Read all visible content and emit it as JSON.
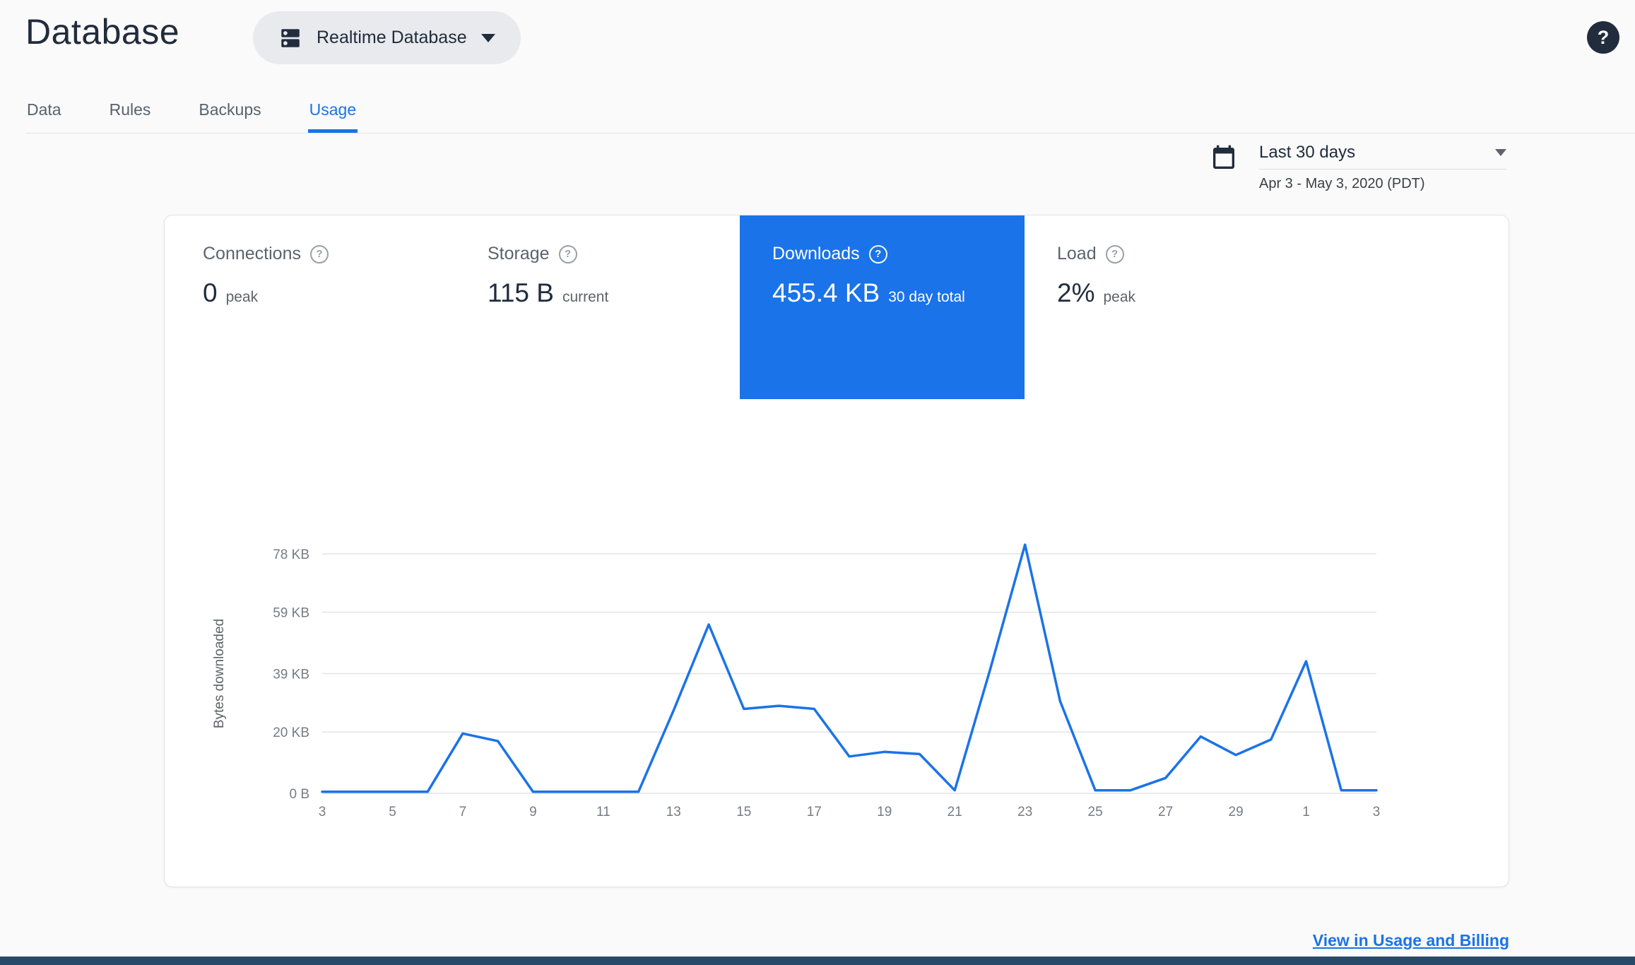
{
  "colors": {
    "accent": "#1a73e8",
    "selected_tile": "#1a73e8",
    "dark_text": "#212c3d",
    "footer_bar": "#27496a"
  },
  "icons": {
    "help_glyph": "?"
  },
  "header": {
    "title": "Database",
    "db_selector_label": "Realtime Database"
  },
  "tabs": [
    {
      "label": "Data",
      "active": false
    },
    {
      "label": "Rules",
      "active": false
    },
    {
      "label": "Backups",
      "active": false
    },
    {
      "label": "Usage",
      "active": true
    }
  ],
  "date_range": {
    "preset": "Last 30 days",
    "range": "Apr 3 - May 3, 2020 (PDT)"
  },
  "metrics": [
    {
      "label": "Connections",
      "value": "0",
      "unit": "peak",
      "selected": false
    },
    {
      "label": "Storage",
      "value": "115 B",
      "unit": "current",
      "selected": false
    },
    {
      "label": "Downloads",
      "value": "455.4 KB",
      "unit": "30 day total",
      "selected": true
    },
    {
      "label": "Load",
      "value": "2%",
      "unit": "peak",
      "selected": false
    }
  ],
  "chart_data": {
    "type": "line",
    "title": "",
    "xlabel": "",
    "ylabel": "Bytes downloaded",
    "unit": "KB",
    "grid": true,
    "legend": false,
    "line_color": "#1a73e8",
    "ylim": [
      0,
      84
    ],
    "y_ticks": [
      {
        "label": "78 KB",
        "value": 78
      },
      {
        "label": "59 KB",
        "value": 59
      },
      {
        "label": "39 KB",
        "value": 39
      },
      {
        "label": "20 KB",
        "value": 20
      },
      {
        "label": "0 B",
        "value": 0
      }
    ],
    "x_tick_labels": [
      "3",
      "5",
      "7",
      "9",
      "11",
      "13",
      "15",
      "17",
      "19",
      "21",
      "23",
      "25",
      "27",
      "29",
      "1",
      "3"
    ],
    "series": [
      {
        "name": "Bytes downloaded",
        "values_kb": [
          0.5,
          0.5,
          0.5,
          0.5,
          19.5,
          17,
          0.5,
          0.5,
          0.5,
          0.5,
          27,
          55,
          27.5,
          28.5,
          27.5,
          12,
          13.5,
          12.8,
          1,
          40,
          81,
          30,
          1,
          1,
          5,
          18.5,
          12.5,
          17.5,
          43,
          1,
          1
        ]
      }
    ]
  },
  "footer": {
    "link_label": "View in Usage and Billing"
  }
}
